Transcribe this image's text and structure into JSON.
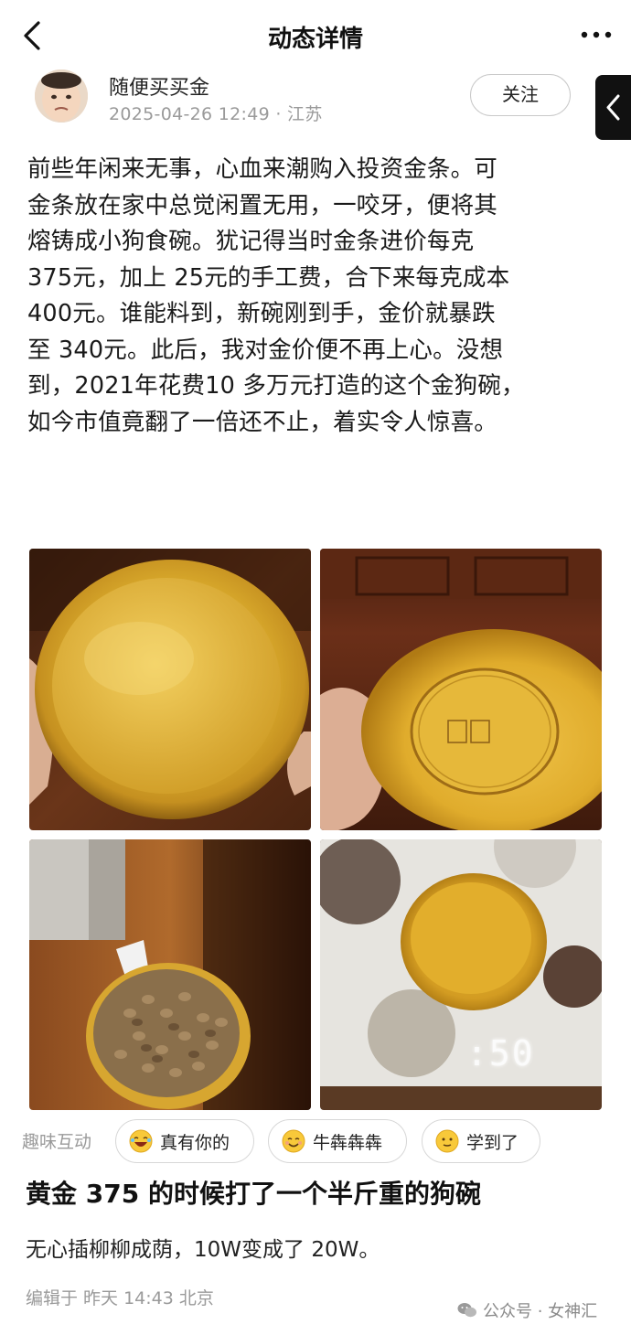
{
  "header": {
    "title": "动态详情",
    "back_icon": "chevron-left-icon",
    "more_icon": "more-dots-icon"
  },
  "author": {
    "name": "随便买买金",
    "date": "2025-04-26 12:49",
    "location": "江苏",
    "meta": "2025-04-26 12:49 · 江苏",
    "follow_label": "关注"
  },
  "post": {
    "body": "前些年闲来无事，心血来潮购入投资金条。可\n金条放在家中总觉闲置无用，一咬牙，便将其\n熔铸成小狗食碗。犹记得当时金条进价每克\n375元，加上 25元的手工费，合下来每克成本\n400元。谁能料到，新碗刚到手，金价就暴跌\n至 340元。此后，我对金价便不再上心。没想\n到，2021年花费10   多万元打造的这个金狗碗，\n如今市值竟翻了一倍还不止，着实令人惊喜。",
    "scale_reading": ":50",
    "title": "黄金 375 的时候打了一个半斤重的狗碗",
    "subtitle": "无心插柳柳成荫，10W变成了 20W。",
    "edit_info": "编辑于  昨天  14:43  北京"
  },
  "interactions": {
    "label": "趣味互动",
    "chips": [
      {
        "label": "真有你的",
        "icon": "laughing-emoji-icon"
      },
      {
        "label": "牛犇犇犇",
        "icon": "smiling-emoji-icon"
      },
      {
        "label": "学到了",
        "icon": "slight-smile-emoji-icon"
      }
    ]
  },
  "watermark": {
    "text": "公众号 · 女神汇",
    "icon": "wechat-icon"
  },
  "colors": {
    "gold": "#d9a92e",
    "gold_dark": "#a67414",
    "wood": "#5a2e17",
    "text_gray": "#9a9a9a"
  }
}
